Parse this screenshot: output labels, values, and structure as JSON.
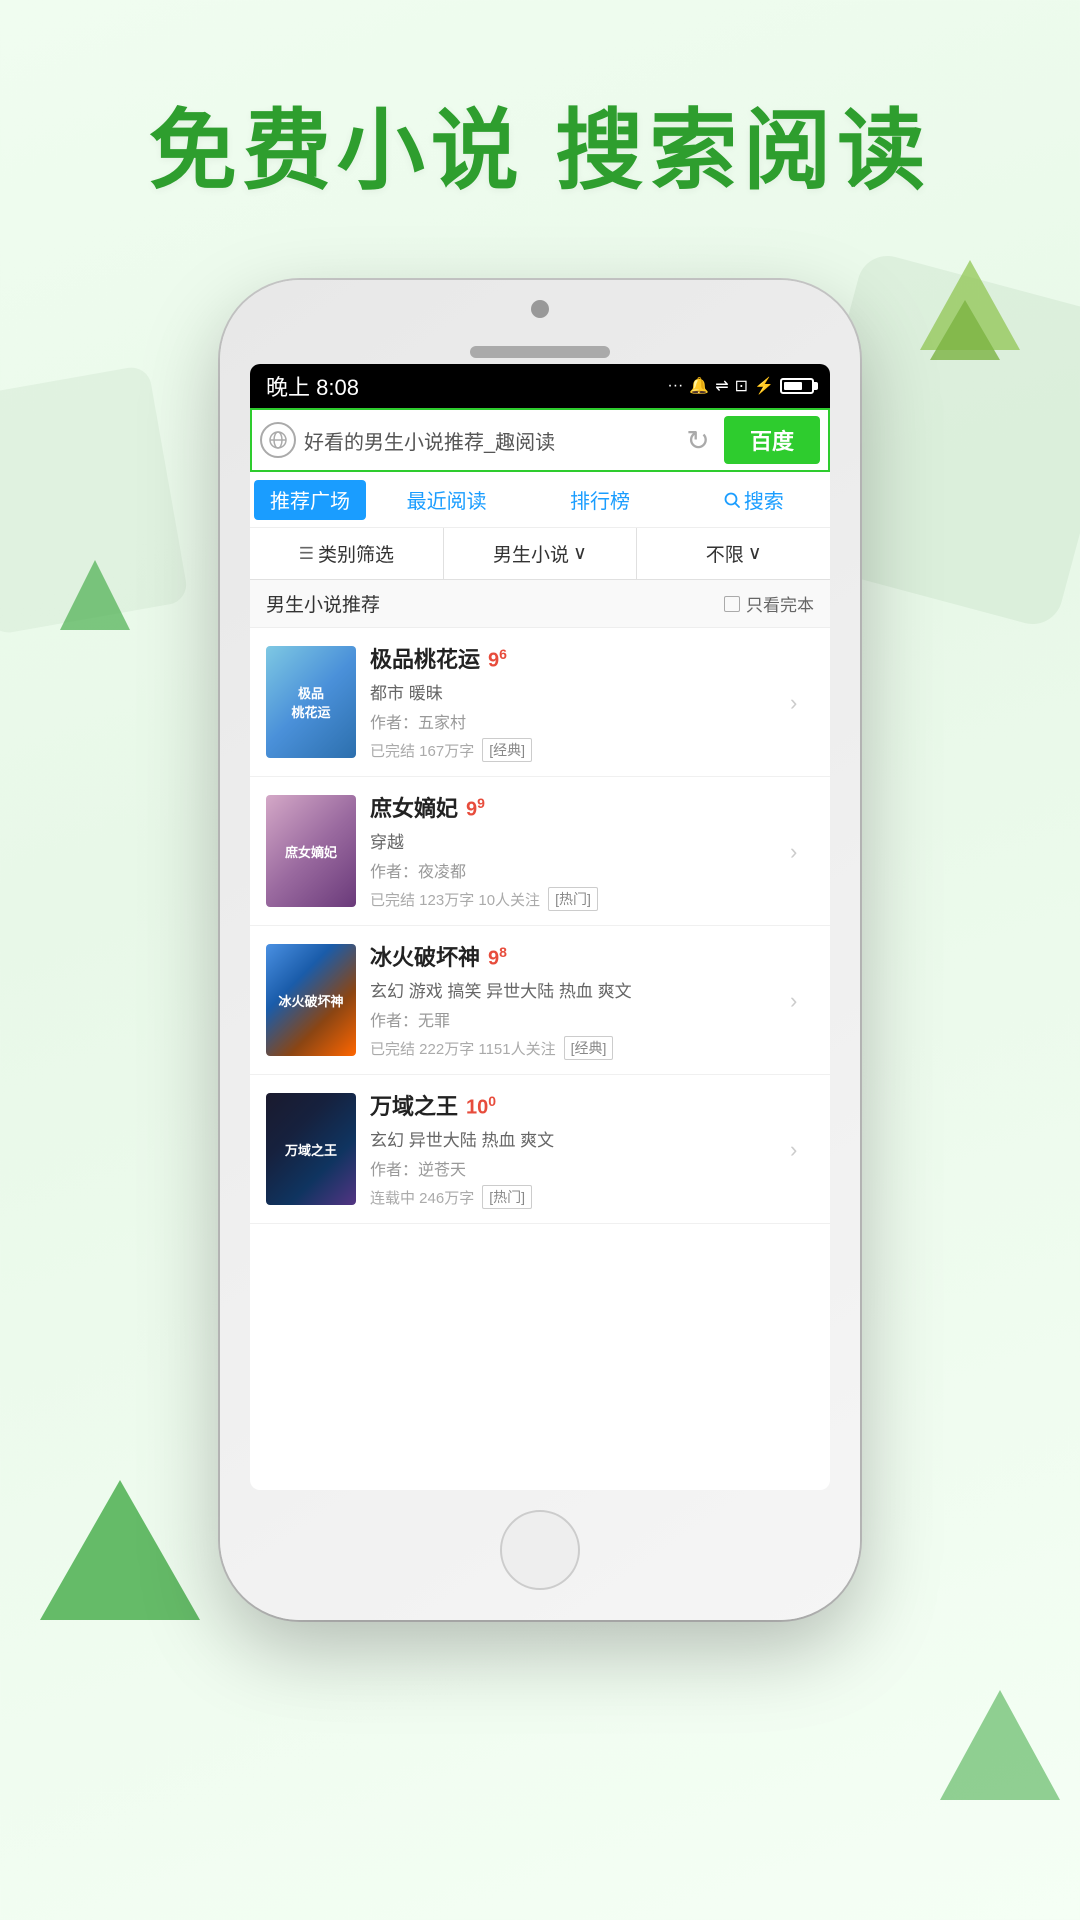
{
  "page": {
    "background": "#f0fdf0",
    "header_text": "免费小说  搜索阅读"
  },
  "status_bar": {
    "time": "晚上 8:08",
    "icons": [
      "...",
      "🔔",
      "WiFi",
      "⊡",
      "⚡"
    ]
  },
  "search_bar": {
    "placeholder": "好看的男生小说推荐_趣阅读",
    "baidu_label": "百度"
  },
  "nav_tabs": [
    {
      "label": "推荐广场",
      "active": true
    },
    {
      "label": "最近阅读",
      "active": false
    },
    {
      "label": "排行榜",
      "active": false
    },
    {
      "label": "搜索",
      "active": false,
      "has_icon": true
    }
  ],
  "filter_bar": {
    "category_label": "类别筛选",
    "genre_label": "男生小说",
    "genre_suffix": "∨",
    "limit_label": "不限",
    "limit_suffix": "∨"
  },
  "section": {
    "title": "男生小说推荐",
    "complete_only_label": "只看完本"
  },
  "books": [
    {
      "title": "极品桃花运",
      "rating": "9",
      "rating_decimal": "6",
      "tags": "都市 暖昧",
      "author": "作者：五家村",
      "meta": "已完结 167万字",
      "badge": "经典",
      "cover_class": "book-cover-1",
      "cover_text": "极品\n桃花运"
    },
    {
      "title": "庶女嫡妃",
      "rating": "9",
      "rating_decimal": "9",
      "tags": "穿越",
      "author": "作者：夜凌都",
      "meta": "已完结 123万字 10人关注",
      "badge": "热门",
      "cover_class": "book-cover-2",
      "cover_text": "庶女嫡妃"
    },
    {
      "title": "冰火破坏神",
      "rating": "9",
      "rating_decimal": "8",
      "tags": "玄幻 游戏 搞笑 异世大陆 热血 爽文",
      "author": "作者：无罪",
      "meta": "已完结 222万字 1151人关注",
      "badge": "经典",
      "cover_class": "book-cover-3",
      "cover_text": "冰火破坏神"
    },
    {
      "title": "万域之王",
      "rating": "10",
      "rating_decimal": "0",
      "tags": "玄幻 异世大陆 热血 爽文",
      "author": "作者：逆苍天",
      "meta": "连载中 246万字",
      "badge": "热门",
      "cover_class": "book-cover-4",
      "cover_text": "万域之王"
    }
  ]
}
